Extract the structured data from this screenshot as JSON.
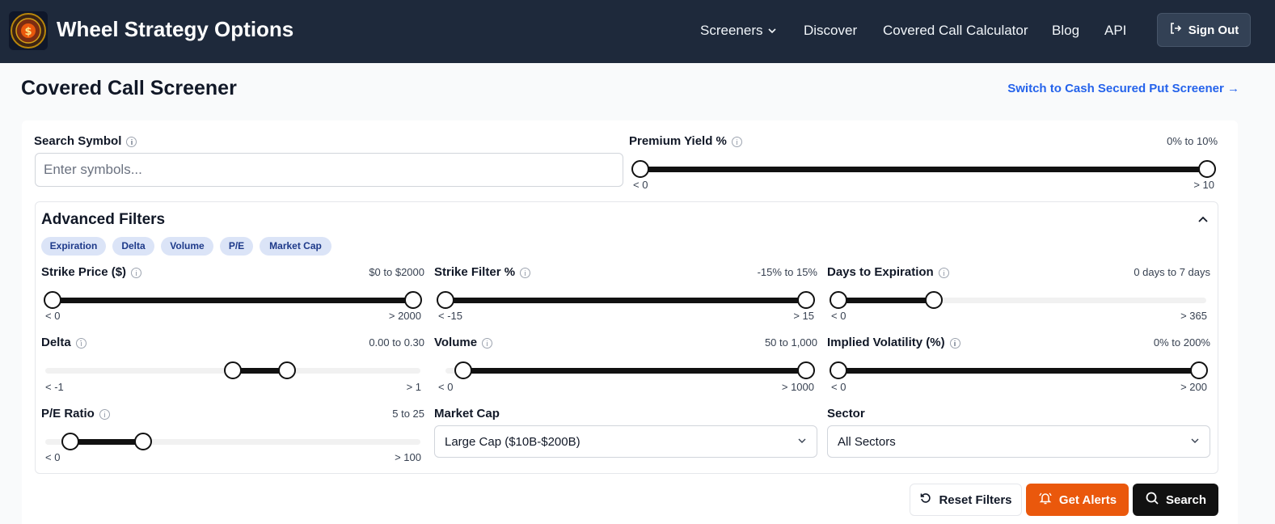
{
  "nav": {
    "brand": "Wheel Strategy Options",
    "links": [
      "Screeners",
      "Discover",
      "Covered Call Calculator",
      "Blog",
      "API"
    ],
    "sign_out": "Sign Out"
  },
  "page": {
    "title": "Covered Call Screener",
    "switch_link": "Switch to Cash Secured Put Screener →"
  },
  "search": {
    "label": "Search Symbol",
    "placeholder": "Enter symbols...",
    "value": ""
  },
  "premium_yield": {
    "label": "Premium Yield %",
    "range_text": "0% to 10%",
    "min_label": "< 0",
    "max_label": "> 10",
    "low": 0,
    "high": 1
  },
  "advanced": {
    "title": "Advanced Filters",
    "chips": [
      "Expiration",
      "Delta",
      "Volume",
      "P/E",
      "Market Cap"
    ],
    "strike_price": {
      "label": "Strike Price ($)",
      "range_text": "$0 to $2000",
      "min_label": "< 0",
      "max_label": "> 2000",
      "low": 0,
      "high": 1
    },
    "strike_filter": {
      "label": "Strike Filter %",
      "range_text": "-15% to 15%",
      "min_label": "< -15",
      "max_label": "> 15",
      "low": 0,
      "high": 1
    },
    "days_to_expiration": {
      "label": "Days to Expiration",
      "range_text": "0 days to 7 days",
      "min_label": "< 0",
      "max_label": "> 365",
      "low": 0,
      "high": 0.26
    },
    "delta": {
      "label": "Delta",
      "range_text": "0.00 to 0.30",
      "min_label": "< -1",
      "max_label": "> 1",
      "low": 0.5,
      "high": 0.645
    },
    "volume": {
      "label": "Volume",
      "range_text": "50 to 1,000",
      "min_label": "< 0",
      "max_label": "> 1000",
      "low": 0.05,
      "high": 1
    },
    "implied_volatility": {
      "label": "Implied Volatility (%)",
      "range_text": "0% to 200%",
      "min_label": "< 0",
      "max_label": "> 200",
      "low": 0,
      "high": 1
    },
    "pe_ratio": {
      "label": "P/E Ratio",
      "range_text": "5 to 25",
      "min_label": "< 0",
      "max_label": "> 100",
      "low": 0.067,
      "high": 0.26
    },
    "market_cap": {
      "label": "Market Cap",
      "value": "Large Cap ($10B-$200B)"
    },
    "sector": {
      "label": "Sector",
      "value": "All Sectors"
    }
  },
  "buttons": {
    "reset": "Reset Filters",
    "alerts": "Get Alerts",
    "search": "Search"
  }
}
